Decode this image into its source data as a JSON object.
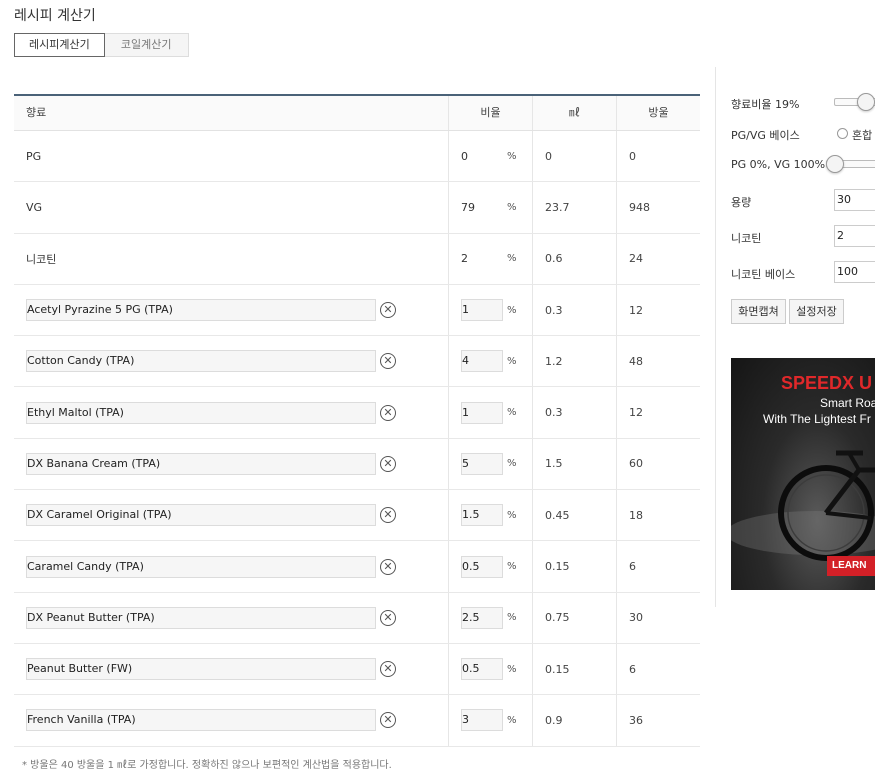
{
  "page_title": "레시피 계산기",
  "tabs": [
    {
      "label": "레시피계산기",
      "active": true
    },
    {
      "label": "코일계산기",
      "active": false
    }
  ],
  "table": {
    "headers": {
      "name": "향료",
      "ratio": "비율",
      "ml": "㎖",
      "drops": "방울"
    },
    "percent_sign": "%",
    "base_rows": [
      {
        "name": "PG",
        "ratio": "0",
        "ml": "0",
        "drops": "0"
      },
      {
        "name": "VG",
        "ratio": "79",
        "ml": "23.7",
        "drops": "948"
      },
      {
        "name": "니코틴",
        "ratio": "2",
        "ml": "0.6",
        "drops": "24"
      }
    ],
    "flavor_rows": [
      {
        "name": "Acetyl Pyrazine 5 PG (TPA)",
        "ratio": "1",
        "ml": "0.3",
        "drops": "12"
      },
      {
        "name": "Cotton Candy (TPA)",
        "ratio": "4",
        "ml": "1.2",
        "drops": "48"
      },
      {
        "name": "Ethyl Maltol (TPA)",
        "ratio": "1",
        "ml": "0.3",
        "drops": "12"
      },
      {
        "name": "DX Banana Cream (TPA)",
        "ratio": "5",
        "ml": "1.5",
        "drops": "60"
      },
      {
        "name": "DX Caramel Original (TPA)",
        "ratio": "1.5",
        "ml": "0.45",
        "drops": "18"
      },
      {
        "name": "Caramel Candy (TPA)",
        "ratio": "0.5",
        "ml": "0.15",
        "drops": "6"
      },
      {
        "name": "DX Peanut Butter (TPA)",
        "ratio": "2.5",
        "ml": "0.75",
        "drops": "30"
      },
      {
        "name": "Peanut Butter (FW)",
        "ratio": "0.5",
        "ml": "0.15",
        "drops": "6"
      },
      {
        "name": "French Vanilla (TPA)",
        "ratio": "3",
        "ml": "0.9",
        "drops": "36"
      }
    ],
    "remove_icon": "close-circle-icon"
  },
  "footnote": "* 방울은 40 방울을 1 ㎖로 가정합니다. 정확하진 않으나 보편적인 계산법을 적용합니다.",
  "sidebar": {
    "flavor_ratio_label": "향료비율 19%",
    "pgvg_base_label": "PG/VG 베이스",
    "pgvg_mix_option": "혼합",
    "pgvg_slider_label": "PG 0%, VG 100%",
    "volume_label": "용량",
    "volume_value": "30",
    "nicotine_label": "니코틴",
    "nicotine_value": "2",
    "nicotine_base_label": "니코틴 베이스",
    "nicotine_base_value": "100",
    "capture_button": "화면캡쳐",
    "save_button": "설정저장"
  },
  "ad": {
    "brand": "SPEEDX U",
    "line1": "Smart Roa",
    "line2": "With The Lightest Fr",
    "cta": "LEARN"
  },
  "colors": {
    "table_header_border": "#4a6278",
    "ad_brand": "#e0282a",
    "ad_cta": "#d32027"
  }
}
